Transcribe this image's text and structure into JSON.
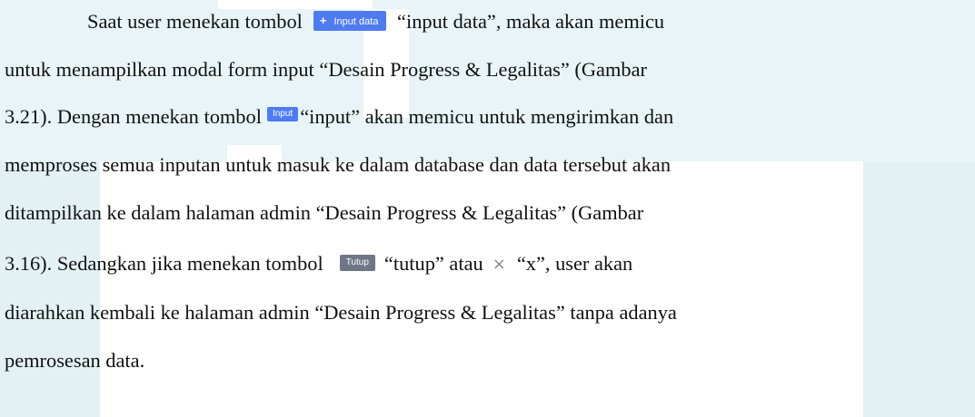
{
  "paragraph": {
    "l1_pre": "Saat user menekan tombol",
    "btn_input_data": "Input data",
    "l1_post": "“input data”, maka akan memicu",
    "l2": "untuk menampilkan modal form input “Desain Progress & Legalitas” (Gambar",
    "l3_pre": "3.21). Dengan menekan tombol",
    "btn_input": "Input",
    "l3_post": "“input” akan memicu untuk mengirimkan dan",
    "l4": "memproses semua inputan untuk masuk ke dalam database dan data tersebut akan",
    "l5": "ditampilkan ke dalam halaman admin “Desain Progress & Legalitas” (Gambar",
    "l6_pre": "3.16). Sedangkan jika menekan tombol",
    "btn_tutup": "Tutup",
    "l6_mid": "“tutup” atau",
    "x_glyph": "×",
    "l6_post": "“x”, user akan",
    "l7": "diarahkan kembali ke halaman admin “Desain Progress & Legalitas” tanpa adanya",
    "l8": "pemrosesan data."
  },
  "icons": {
    "plus": "+",
    "x": "close-icon"
  },
  "colors": {
    "primary_button": "#4e7bf0",
    "secondary_button": "#6e7687",
    "watermark": "#dff0f5"
  }
}
